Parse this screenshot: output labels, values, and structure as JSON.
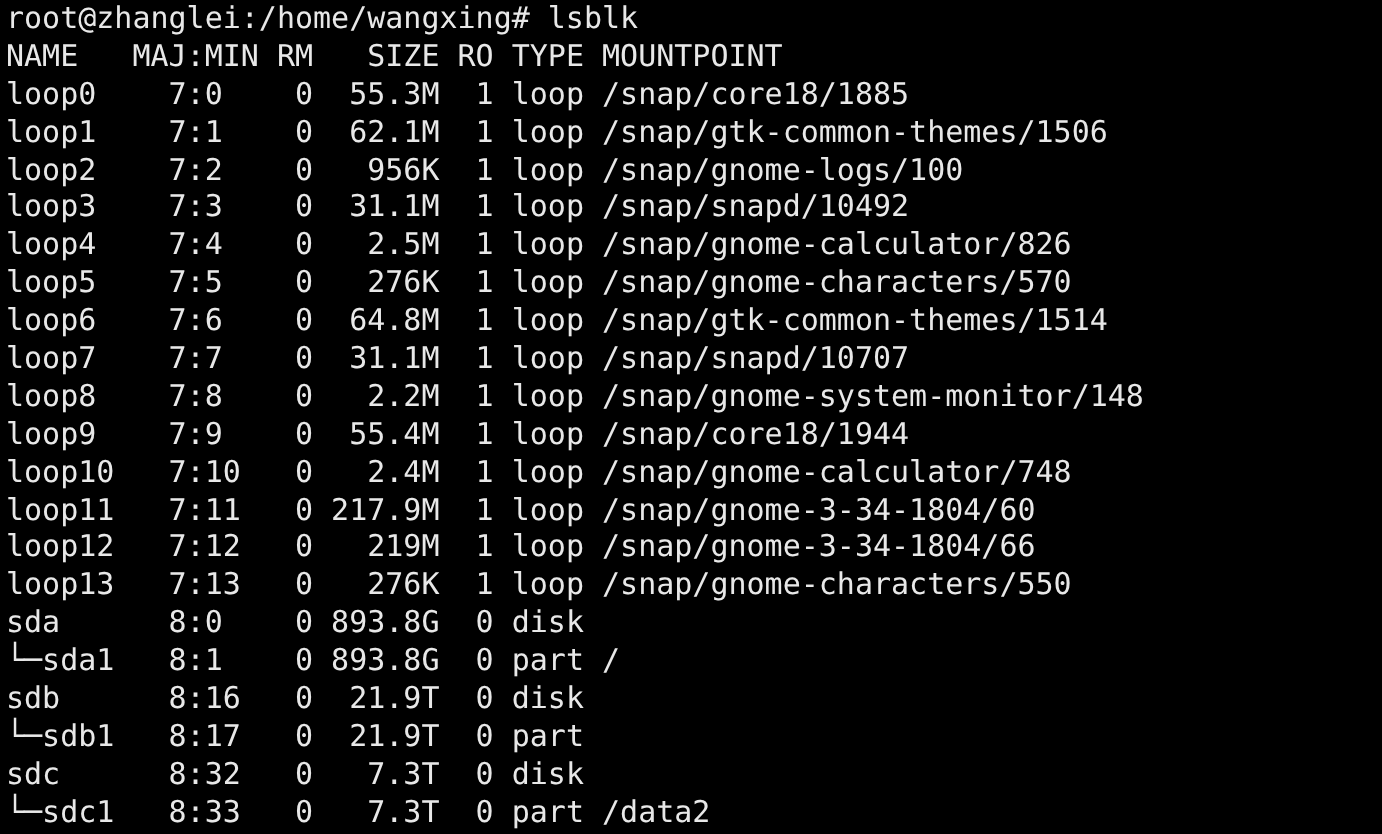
{
  "terminal": {
    "prompt": "root@zhanglei:/home/wangxing#",
    "command": "lsblk",
    "output_lines": [
      "NAME   MAJ:MIN RM   SIZE RO TYPE MOUNTPOINT",
      "loop0    7:0    0  55.3M  1 loop /snap/core18/1885",
      "loop1    7:1    0  62.1M  1 loop /snap/gtk-common-themes/1506",
      "loop2    7:2    0   956K  1 loop /snap/gnome-logs/100",
      "loop3    7:3    0  31.1M  1 loop /snap/snapd/10492",
      "loop4    7:4    0   2.5M  1 loop /snap/gnome-calculator/826",
      "loop5    7:5    0   276K  1 loop /snap/gnome-characters/570",
      "loop6    7:6    0  64.8M  1 loop /snap/gtk-common-themes/1514",
      "loop7    7:7    0  31.1M  1 loop /snap/snapd/10707",
      "loop8    7:8    0   2.2M  1 loop /snap/gnome-system-monitor/148",
      "loop9    7:9    0  55.4M  1 loop /snap/core18/1944",
      "loop10   7:10   0   2.4M  1 loop /snap/gnome-calculator/748",
      "loop11   7:11   0 217.9M  1 loop /snap/gnome-3-34-1804/60",
      "loop12   7:12   0   219M  1 loop /snap/gnome-3-34-1804/66",
      "loop13   7:13   0   276K  1 loop /snap/gnome-characters/550",
      "sda      8:0    0 893.8G  0 disk",
      "└─sda1   8:1    0 893.8G  0 part /",
      "sdb      8:16   0  21.9T  0 disk",
      "└─sdb1   8:17   0  21.9T  0 part",
      "sdc      8:32   0   7.3T  0 disk",
      "└─sdc1   8:33   0   7.3T  0 part /data2"
    ]
  }
}
